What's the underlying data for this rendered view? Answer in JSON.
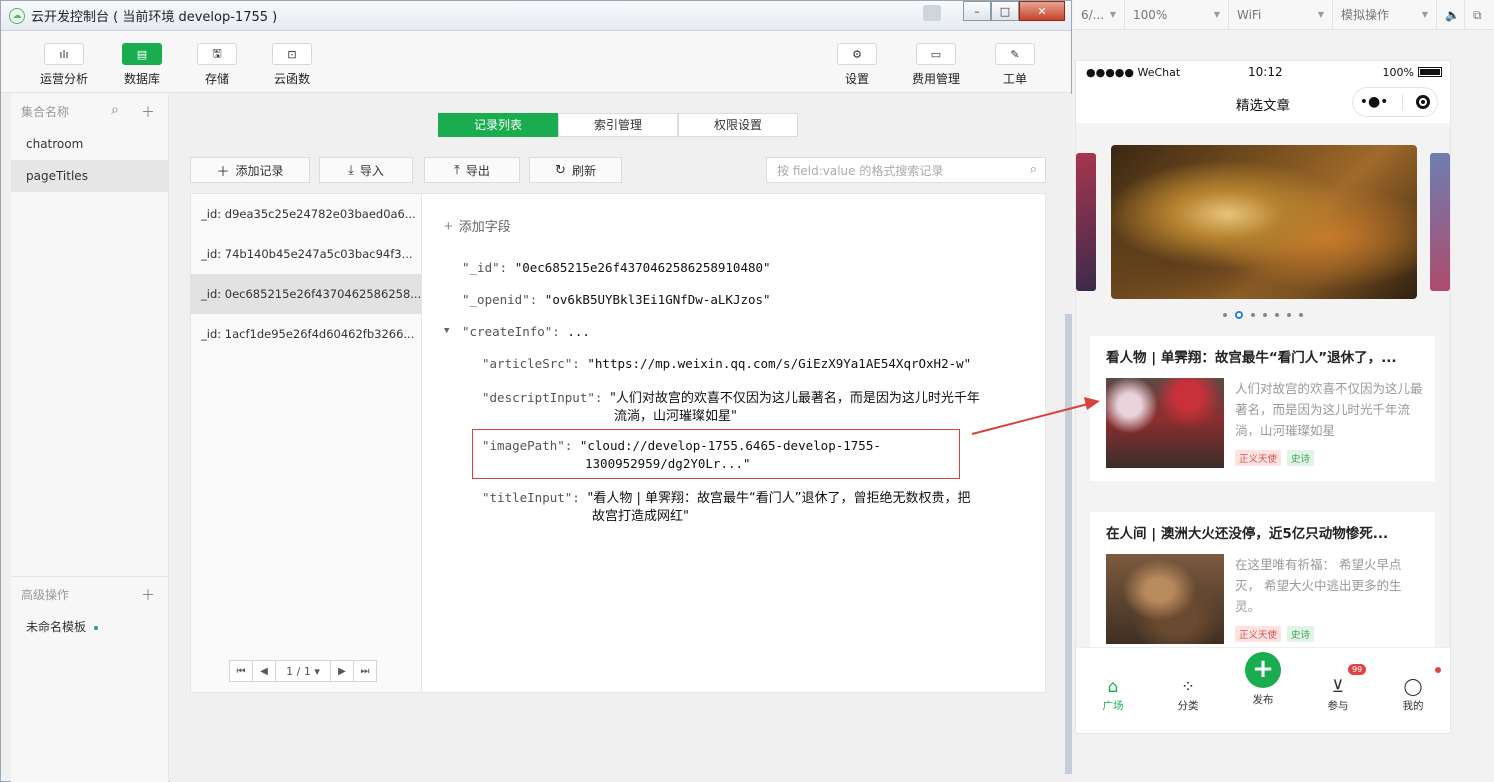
{
  "window": {
    "title": "云开发控制台 ( 当前环境 develop-1755 )",
    "controls": [
      "–",
      "□",
      "✕"
    ]
  },
  "toolbar": {
    "items": [
      {
        "label": "运营分析",
        "icon": "chart-icon",
        "glyph": "ılı"
      },
      {
        "label": "数据库",
        "icon": "database-icon",
        "glyph": "▤"
      },
      {
        "label": "存储",
        "icon": "storage-icon",
        "glyph": "🖫"
      },
      {
        "label": "云函数",
        "icon": "function-icon",
        "glyph": "⊡"
      },
      {
        "label": "设置",
        "icon": "gear-icon",
        "glyph": "⚙"
      },
      {
        "label": "费用管理",
        "icon": "billing-icon",
        "glyph": "▭"
      },
      {
        "label": "工单",
        "icon": "ticket-icon",
        "glyph": "✎"
      }
    ]
  },
  "sidebar": {
    "header": "集合名称",
    "collections": [
      "chatroom",
      "pageTitles"
    ],
    "selected": "pageTitles",
    "advanced_header": "高级操作",
    "templates": [
      "未命名模板"
    ]
  },
  "segments": [
    "记录列表",
    "索引管理",
    "权限设置"
  ],
  "actions": {
    "add": "添加记录",
    "import": "导入",
    "export": "导出",
    "refresh": "刷新"
  },
  "search": {
    "placeholder": "按 field:value 的格式搜索记录"
  },
  "records": [
    "_id: d9ea35c25e24782e03baed0a6...",
    "_id: 74b140b45e247a5c03bac94f3...",
    "_id: 0ec685215e26f4370462586258...",
    "_id: 1acf1de95e26f4d60462fb3266..."
  ],
  "pager": {
    "first": "⏮",
    "prev": "◀",
    "page": "1 / 1 ▾",
    "next": "▶",
    "last": "⏭"
  },
  "detail": {
    "add_field": "添加字段",
    "id_key": "\"_id\":",
    "id_val": "\"0ec685215e26f4370462586258910480\"",
    "openid_key": "\"_openid\":",
    "openid_val": "\"ov6kB5UYBkl3Ei1GNfDw-aLKJzos\"",
    "createinfo_key": "\"createInfo\":",
    "createinfo_val": "...",
    "articlesrc_key": "\"articleSrc\":",
    "articlesrc_val": "\"https://mp.weixin.qq.com/s/GiEzX9Ya1AE54XqrOxH2-w\"",
    "descript_key": "\"descriptInput\":",
    "descript_val_1": "\"人们对故宫的欢喜不仅因为这儿最著名，而是因为这儿时光千年",
    "descript_val_2": "流淌，山河璀璨如星\"",
    "imagepath_key": "\"imagePath\":",
    "imagepath_val_1": "\"cloud://develop-1755.6465-develop-1755-",
    "imagepath_val_2": "1300952959/dg2Y0Lr...\"",
    "title_key": "\"titleInput\":",
    "title_val_1": "\"看人物 | 单霁翔：故宫最牛“看门人”退休了，曾拒绝无数权贵，把",
    "title_val_2": "故宫打造成网红\""
  },
  "simulator": {
    "selectors": [
      "6/...",
      "100%",
      "WiFi",
      "模拟操作"
    ],
    "status": {
      "carrier": "●●●●● WeChat",
      "time": "10:12",
      "battery": "100%"
    },
    "nav_title": "精选文章",
    "cards": [
      {
        "title": "看人物 | 单霁翔：故宫最牛“看门人”退休了，...",
        "desc": "人们对故宫的欢喜不仅因为这儿最著名，而是因为这儿时光千年流淌，山河璀璨如星",
        "tags": [
          "正义天使",
          "史诗"
        ]
      },
      {
        "title": "在人间 | 澳洲大火还没停，近5亿只动物惨死...",
        "desc": "在这里唯有祈福： 希望火早点灭， 希望大火中逃出更多的生灵。",
        "tags": [
          "正义天使",
          "史诗"
        ]
      }
    ],
    "tabs": [
      "广场",
      "分类",
      "发布",
      "参与",
      "我的"
    ],
    "badge": "99"
  },
  "colors": {
    "accent": "#1aad50",
    "highlight": "#d9413b"
  }
}
